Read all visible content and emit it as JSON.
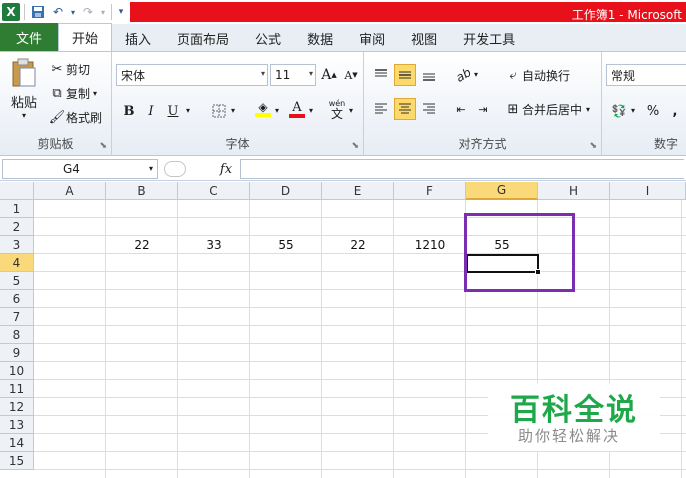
{
  "window": {
    "title": "工作簿1 - Microsoft"
  },
  "tabs": [
    {
      "label": "文件"
    },
    {
      "label": "开始"
    },
    {
      "label": "插入"
    },
    {
      "label": "页面布局"
    },
    {
      "label": "公式"
    },
    {
      "label": "数据"
    },
    {
      "label": "审阅"
    },
    {
      "label": "视图"
    },
    {
      "label": "开发工具"
    }
  ],
  "ribbon": {
    "clipboard": {
      "paste": "粘贴",
      "cut": "剪切",
      "copy": "复制",
      "format_painter": "格式刷",
      "label": "剪贴板"
    },
    "font": {
      "name": "宋体",
      "size": "11",
      "grow": "A",
      "shrink": "A",
      "bold": "B",
      "italic": "I",
      "underline": "U",
      "font_color": "A",
      "phonetic_top": "wén",
      "phonetic_bottom": "文",
      "label": "字体"
    },
    "alignment": {
      "wrap_text": "自动换行",
      "merge_center": "合并后居中",
      "label": "对齐方式"
    },
    "number": {
      "format": "常规",
      "percent": "%",
      "comma": ",",
      "label": "数字"
    }
  },
  "formula_bar": {
    "name_box": "G4",
    "fx": "fx",
    "value": ""
  },
  "sheet": {
    "columns": [
      "A",
      "B",
      "C",
      "D",
      "E",
      "F",
      "G",
      "H",
      "I"
    ],
    "rows": [
      "1",
      "2",
      "3",
      "4",
      "5",
      "6",
      "7",
      "8",
      "9",
      "10",
      "11",
      "12",
      "13",
      "14",
      "15"
    ],
    "selected_column": "G",
    "selected_row": "4",
    "row3": {
      "B": "22",
      "C": "33",
      "D": "55",
      "E": "22",
      "F": "1210",
      "G": "55"
    }
  },
  "watermark": {
    "title": "百科全说",
    "subtitle": "助你轻松解决"
  },
  "colors": {
    "file_tab": "#2e7d32",
    "title_red": "#e8101a",
    "highlight": "#7b2fb0",
    "selected_header": "#f9d97a",
    "watermark_green": "#1fa84a"
  }
}
